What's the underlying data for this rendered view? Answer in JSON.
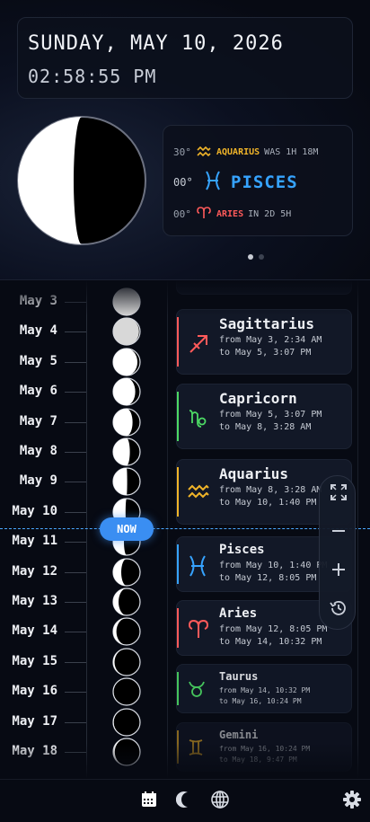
{
  "header": {
    "date": "SUNDAY, MAY 10, 2026",
    "time": "02:58:55 PM"
  },
  "zodiac_now": {
    "previous": {
      "degree": "30°",
      "sign": "AQUARIUS",
      "relation": "WAS 1H 18M",
      "color": "#f0b429",
      "icon": "aquarius-icon"
    },
    "current": {
      "degree": "00°",
      "sign": "PISCES",
      "color": "#36a3ff",
      "icon": "pisces-icon"
    },
    "next": {
      "degree": "00°",
      "sign": "ARIES",
      "relation": "IN 2D 5H",
      "color": "#ff5a5a",
      "icon": "aries-icon"
    }
  },
  "pager": {
    "pages": 2,
    "active": 1
  },
  "timeline": {
    "days": [
      "May 3",
      "May 4",
      "May 5",
      "May 6",
      "May 7",
      "May 8",
      "May 9",
      "May 10",
      "May 11",
      "May 12",
      "May 13",
      "May 14",
      "May 15",
      "May 16",
      "May 17",
      "May 18"
    ],
    "now_label": "NOW",
    "signs": [
      {
        "name": "Sagittarius",
        "from": "from May 3, 2:34 AM",
        "to": "to May 5, 3:07 PM",
        "color": "#ff5a5a",
        "icon": "sagittarius-icon"
      },
      {
        "name": "Capricorn",
        "from": "from May 5, 3:07 PM",
        "to": "to May 8, 3:28 AM",
        "color": "#4cd964",
        "icon": "capricorn-icon"
      },
      {
        "name": "Aquarius",
        "from": "from May 8, 3:28 AM",
        "to": "to May 10, 1:40 PM",
        "color": "#f0b429",
        "icon": "aquarius-icon"
      },
      {
        "name": "Pisces",
        "from": "from May 10, 1:40 PM",
        "to": "to May 12, 8:05 PM",
        "color": "#36a3ff",
        "icon": "pisces-icon"
      },
      {
        "name": "Aries",
        "from": "from May 12, 8:05 PM",
        "to": "to May 14, 10:32 PM",
        "color": "#ff5a5a",
        "icon": "aries-icon"
      },
      {
        "name": "Taurus",
        "from": "from May 14, 10:32 PM",
        "to": "to May 16, 10:24 PM",
        "color": "#4cd964",
        "icon": "taurus-icon"
      },
      {
        "name": "Gemini",
        "from": "from May 16, 10:24 PM",
        "to": "to May 18, 9:47 PM",
        "color": "#f0b429",
        "icon": "gemini-icon"
      }
    ]
  },
  "controls": {
    "icons": [
      "fit-screen-icon",
      "zoom-out-icon",
      "zoom-in-icon",
      "history-icon"
    ]
  },
  "bottom_nav": {
    "icons": [
      "calendar-icon",
      "moon-icon",
      "globe-icon",
      "settings-icon"
    ]
  }
}
